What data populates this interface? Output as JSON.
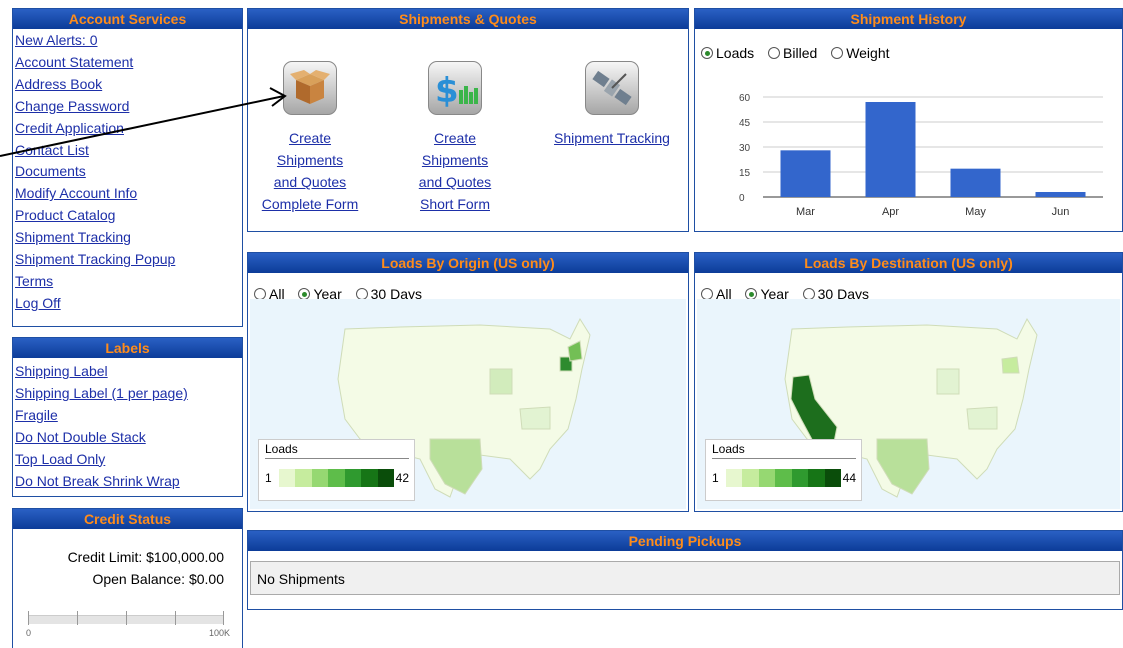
{
  "account_services": {
    "title": "Account Services",
    "links": [
      "New Alerts: 0",
      "Account Statement",
      "Address Book",
      "Change Password",
      "Credit Application",
      "Contact List",
      "Documents",
      "Modify Account Info",
      "Product Catalog",
      "Shipment Tracking",
      "Shipment Tracking Popup",
      "Terms",
      "Log Off"
    ]
  },
  "labels": {
    "title": "Labels",
    "links": [
      "Shipping Label",
      "Shipping Label (1 per page)",
      "Fragile",
      "Do Not Double Stack",
      "Top Load Only",
      "Do Not Break Shrink Wrap"
    ]
  },
  "credit_status": {
    "title": "Credit Status",
    "limit": "Credit Limit: $100,000.00",
    "balance": "Open Balance: $0.00",
    "scale_min": "0",
    "scale_max": "100K",
    "used_fraction": 0
  },
  "shipments_quotes": {
    "title": "Shipments & Quotes",
    "items": [
      {
        "icon": "box-icon",
        "line1": "Create Shipments",
        "line2": "and Quotes",
        "line3": "Complete Form"
      },
      {
        "icon": "dollar-chart-icon",
        "line1": "Create Shipments",
        "line2": "and Quotes",
        "line3": "Short Form"
      },
      {
        "icon": "satellite-icon",
        "line1": "Shipment Tracking",
        "line2": "",
        "line3": ""
      }
    ]
  },
  "shipment_history": {
    "title": "Shipment History",
    "options": [
      "Loads",
      "Billed",
      "Weight"
    ],
    "selected": "Loads"
  },
  "chart_data": {
    "type": "bar",
    "categories": [
      "Mar",
      "Apr",
      "May",
      "Jun"
    ],
    "values": [
      28,
      57,
      17,
      3
    ],
    "ylim": [
      0,
      60
    ],
    "yticks": [
      "60",
      "45",
      "30",
      "15",
      "0"
    ],
    "color": "#3366cc",
    "grid": true
  },
  "loads_origin": {
    "title": "Loads By Origin (US only)",
    "options": [
      "All",
      "Year",
      "30 Days"
    ],
    "selected": "Year",
    "legend_title": "Loads",
    "legend_min": "1",
    "legend_max": "42"
  },
  "loads_destination": {
    "title": "Loads By Destination (US only)",
    "options": [
      "All",
      "Year",
      "30 Days"
    ],
    "selected": "Year",
    "legend_title": "Loads",
    "legend_min": "1",
    "legend_max": "44"
  },
  "pending_pickups": {
    "title": "Pending Pickups",
    "message": "No Shipments"
  }
}
